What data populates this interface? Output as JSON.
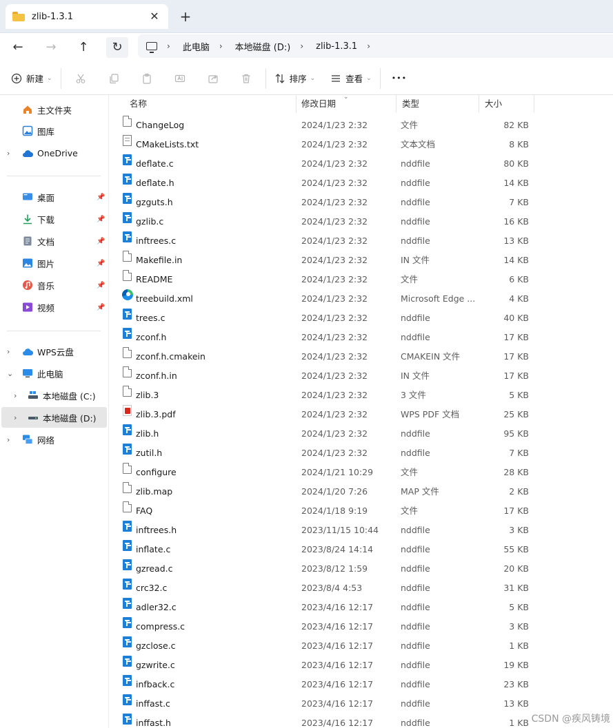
{
  "window": {
    "tab_title": "zlib-1.3.1",
    "close_glyph": "✕",
    "new_tab_glyph": "+"
  },
  "nav": {
    "back_glyph": "←",
    "forward_glyph": "→",
    "up_glyph": "↑",
    "refresh_glyph": "↻"
  },
  "breadcrumb": {
    "items": [
      "此电脑",
      "本地磁盘 (D:)",
      "zlib-1.3.1"
    ],
    "separator": "›"
  },
  "toolbar": {
    "new_label": "新建",
    "sort_label": "排序",
    "view_label": "查看",
    "more_glyph": "•••",
    "icons": [
      "cut-icon",
      "copy-icon",
      "paste-icon",
      "rename-icon",
      "share-icon",
      "delete-icon"
    ]
  },
  "sidebar": {
    "quick": [
      {
        "label": "主文件夹",
        "icon": "home-icon",
        "color": "#e8852a"
      },
      {
        "label": "图库",
        "icon": "gallery-icon",
        "color": "#2a7fd6"
      },
      {
        "label": "OneDrive",
        "icon": "cloud-icon",
        "color": "#1f74d4",
        "expandable": true
      }
    ],
    "pinned": [
      {
        "label": "桌面",
        "icon": "desktop-icon",
        "color": "#3a8ee6"
      },
      {
        "label": "下载",
        "icon": "download-icon",
        "color": "#1f9e5a"
      },
      {
        "label": "文档",
        "icon": "documents-icon",
        "color": "#7b8a9c"
      },
      {
        "label": "图片",
        "icon": "pictures-icon",
        "color": "#2a86e2"
      },
      {
        "label": "音乐",
        "icon": "music-icon",
        "color": "#e35a4a"
      },
      {
        "label": "视频",
        "icon": "videos-icon",
        "color": "#8a4ad8"
      }
    ],
    "pin_glyph": "📌",
    "drives": [
      {
        "label": "WPS云盘",
        "icon": "wps-cloud-icon",
        "color": "#2b8be8",
        "level": 0,
        "expander": "›"
      },
      {
        "label": "此电脑",
        "icon": "this-pc-icon",
        "color": "#2b8be8",
        "level": 0,
        "expander": "⌄"
      },
      {
        "label": "本地磁盘 (C:)",
        "icon": "drive-c-icon",
        "color": "#4a5866",
        "level": 1,
        "expander": "›"
      },
      {
        "label": "本地磁盘 (D:)",
        "icon": "drive-d-icon",
        "color": "#4a5866",
        "level": 1,
        "expander": "›",
        "selected": true
      },
      {
        "label": "网络",
        "icon": "network-icon",
        "color": "#2b8be8",
        "level": 0,
        "expander": "›"
      }
    ]
  },
  "columns": [
    "名称",
    "修改日期",
    "类型",
    "大小"
  ],
  "files": [
    {
      "name": "ChangeLog",
      "date": "2024/1/23 2:32",
      "type": "文件",
      "size": "82 KB",
      "icon": "doc"
    },
    {
      "name": "CMakeLists.txt",
      "date": "2024/1/23 2:32",
      "type": "文本文档",
      "size": "8 KB",
      "icon": "txt"
    },
    {
      "name": "deflate.c",
      "date": "2024/1/23 2:32",
      "type": "nddfile",
      "size": "80 KB",
      "icon": "ndd"
    },
    {
      "name": "deflate.h",
      "date": "2024/1/23 2:32",
      "type": "nddfile",
      "size": "14 KB",
      "icon": "ndd"
    },
    {
      "name": "gzguts.h",
      "date": "2024/1/23 2:32",
      "type": "nddfile",
      "size": "7 KB",
      "icon": "ndd"
    },
    {
      "name": "gzlib.c",
      "date": "2024/1/23 2:32",
      "type": "nddfile",
      "size": "16 KB",
      "icon": "ndd"
    },
    {
      "name": "inftrees.c",
      "date": "2024/1/23 2:32",
      "type": "nddfile",
      "size": "13 KB",
      "icon": "ndd"
    },
    {
      "name": "Makefile.in",
      "date": "2024/1/23 2:32",
      "type": "IN 文件",
      "size": "14 KB",
      "icon": "doc"
    },
    {
      "name": "README",
      "date": "2024/1/23 2:32",
      "type": "文件",
      "size": "6 KB",
      "icon": "doc"
    },
    {
      "name": "treebuild.xml",
      "date": "2024/1/23 2:32",
      "type": "Microsoft Edge ...",
      "size": "4 KB",
      "icon": "edge"
    },
    {
      "name": "trees.c",
      "date": "2024/1/23 2:32",
      "type": "nddfile",
      "size": "40 KB",
      "icon": "ndd"
    },
    {
      "name": "zconf.h",
      "date": "2024/1/23 2:32",
      "type": "nddfile",
      "size": "17 KB",
      "icon": "ndd"
    },
    {
      "name": "zconf.h.cmakein",
      "date": "2024/1/23 2:32",
      "type": "CMAKEIN 文件",
      "size": "17 KB",
      "icon": "doc"
    },
    {
      "name": "zconf.h.in",
      "date": "2024/1/23 2:32",
      "type": "IN 文件",
      "size": "17 KB",
      "icon": "doc"
    },
    {
      "name": "zlib.3",
      "date": "2024/1/23 2:32",
      "type": "3 文件",
      "size": "5 KB",
      "icon": "doc"
    },
    {
      "name": "zlib.3.pdf",
      "date": "2024/1/23 2:32",
      "type": "WPS PDF 文档",
      "size": "25 KB",
      "icon": "pdf"
    },
    {
      "name": "zlib.h",
      "date": "2024/1/23 2:32",
      "type": "nddfile",
      "size": "95 KB",
      "icon": "ndd"
    },
    {
      "name": "zutil.h",
      "date": "2024/1/23 2:32",
      "type": "nddfile",
      "size": "7 KB",
      "icon": "ndd"
    },
    {
      "name": "configure",
      "date": "2024/1/21 10:29",
      "type": "文件",
      "size": "28 KB",
      "icon": "doc"
    },
    {
      "name": "zlib.map",
      "date": "2024/1/20 7:26",
      "type": "MAP 文件",
      "size": "2 KB",
      "icon": "doc"
    },
    {
      "name": "FAQ",
      "date": "2024/1/18 9:19",
      "type": "文件",
      "size": "17 KB",
      "icon": "doc"
    },
    {
      "name": "inftrees.h",
      "date": "2023/11/15 10:44",
      "type": "nddfile",
      "size": "3 KB",
      "icon": "ndd"
    },
    {
      "name": "inflate.c",
      "date": "2023/8/24 14:14",
      "type": "nddfile",
      "size": "55 KB",
      "icon": "ndd"
    },
    {
      "name": "gzread.c",
      "date": "2023/8/12 1:59",
      "type": "nddfile",
      "size": "20 KB",
      "icon": "ndd"
    },
    {
      "name": "crc32.c",
      "date": "2023/8/4 4:53",
      "type": "nddfile",
      "size": "31 KB",
      "icon": "ndd"
    },
    {
      "name": "adler32.c",
      "date": "2023/4/16 12:17",
      "type": "nddfile",
      "size": "5 KB",
      "icon": "ndd"
    },
    {
      "name": "compress.c",
      "date": "2023/4/16 12:17",
      "type": "nddfile",
      "size": "3 KB",
      "icon": "ndd"
    },
    {
      "name": "gzclose.c",
      "date": "2023/4/16 12:17",
      "type": "nddfile",
      "size": "1 KB",
      "icon": "ndd"
    },
    {
      "name": "gzwrite.c",
      "date": "2023/4/16 12:17",
      "type": "nddfile",
      "size": "19 KB",
      "icon": "ndd"
    },
    {
      "name": "infback.c",
      "date": "2023/4/16 12:17",
      "type": "nddfile",
      "size": "23 KB",
      "icon": "ndd"
    },
    {
      "name": "inffast.c",
      "date": "2023/4/16 12:17",
      "type": "nddfile",
      "size": "13 KB",
      "icon": "ndd"
    },
    {
      "name": "inffast.h",
      "date": "2023/4/16 12:17",
      "type": "nddfile",
      "size": "1 KB",
      "icon": "ndd"
    }
  ],
  "watermark": "CSDN @疾风铸境"
}
